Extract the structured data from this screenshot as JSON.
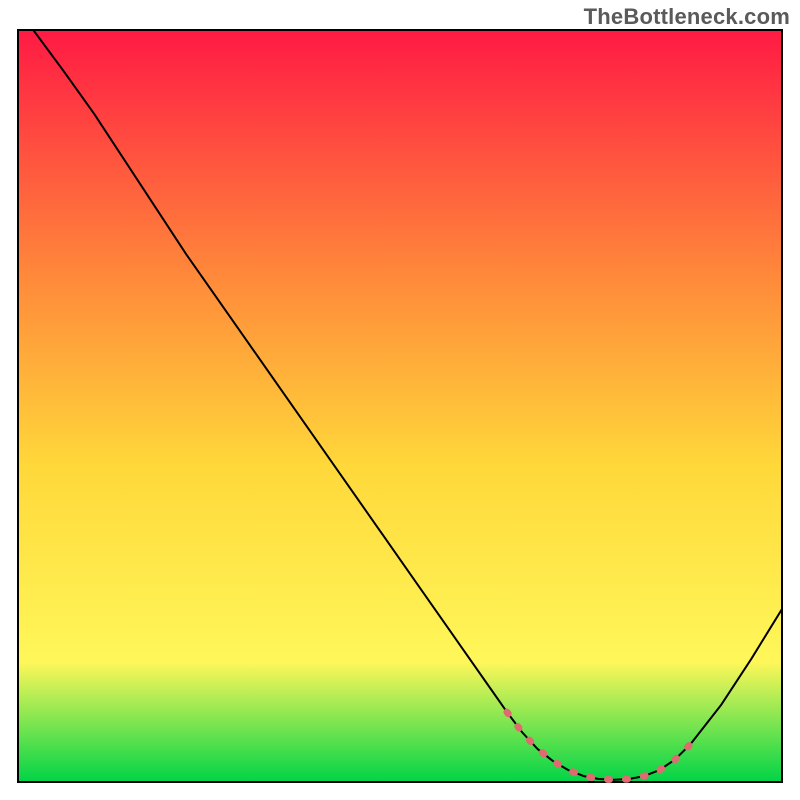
{
  "watermark": "TheBottleneck.com",
  "chart_data": {
    "type": "line",
    "title": "",
    "xlabel": "",
    "ylabel": "",
    "xlim": [
      0,
      100
    ],
    "ylim": [
      0,
      100
    ],
    "grid": false,
    "gradient": {
      "top": "#ff1a44",
      "upper_mid": "#ff8a3a",
      "mid": "#ffd83a",
      "lower_mid": "#fff75a",
      "bottom": "#00d447"
    },
    "series": [
      {
        "name": "bottleneck-curve",
        "color": "#000000",
        "width": 2,
        "x": [
          2.0,
          6.0,
          10.0,
          14.0,
          18.0,
          22.0,
          26.0,
          30.0,
          34.0,
          38.0,
          42.0,
          46.0,
          50.0,
          54.0,
          58.0,
          62.0,
          64.0,
          66.0,
          68.0,
          70.0,
          72.0,
          74.0,
          76.0,
          78.0,
          80.0,
          82.0,
          84.0,
          86.0,
          88.0,
          92.0,
          96.0,
          100.0
        ],
        "y": [
          100.0,
          94.5,
          88.8,
          82.6,
          76.4,
          70.2,
          64.4,
          58.6,
          52.8,
          47.0,
          41.2,
          35.4,
          29.6,
          23.8,
          18.0,
          12.2,
          9.3,
          6.6,
          4.4,
          2.8,
          1.6,
          0.8,
          0.4,
          0.3,
          0.4,
          0.8,
          1.6,
          3.0,
          5.0,
          10.2,
          16.4,
          23.0
        ]
      },
      {
        "name": "optimal-zone-marker",
        "color": "#e06a72",
        "width": 7,
        "x": [
          64.0,
          66.0,
          68.0,
          70.0,
          72.0,
          74.0,
          76.0,
          78.0,
          80.0,
          82.0,
          84.0,
          86.0,
          88.0
        ],
        "y": [
          9.3,
          6.6,
          4.4,
          2.8,
          1.6,
          0.8,
          0.4,
          0.3,
          0.4,
          0.8,
          1.6,
          3.0,
          5.0
        ]
      }
    ]
  }
}
